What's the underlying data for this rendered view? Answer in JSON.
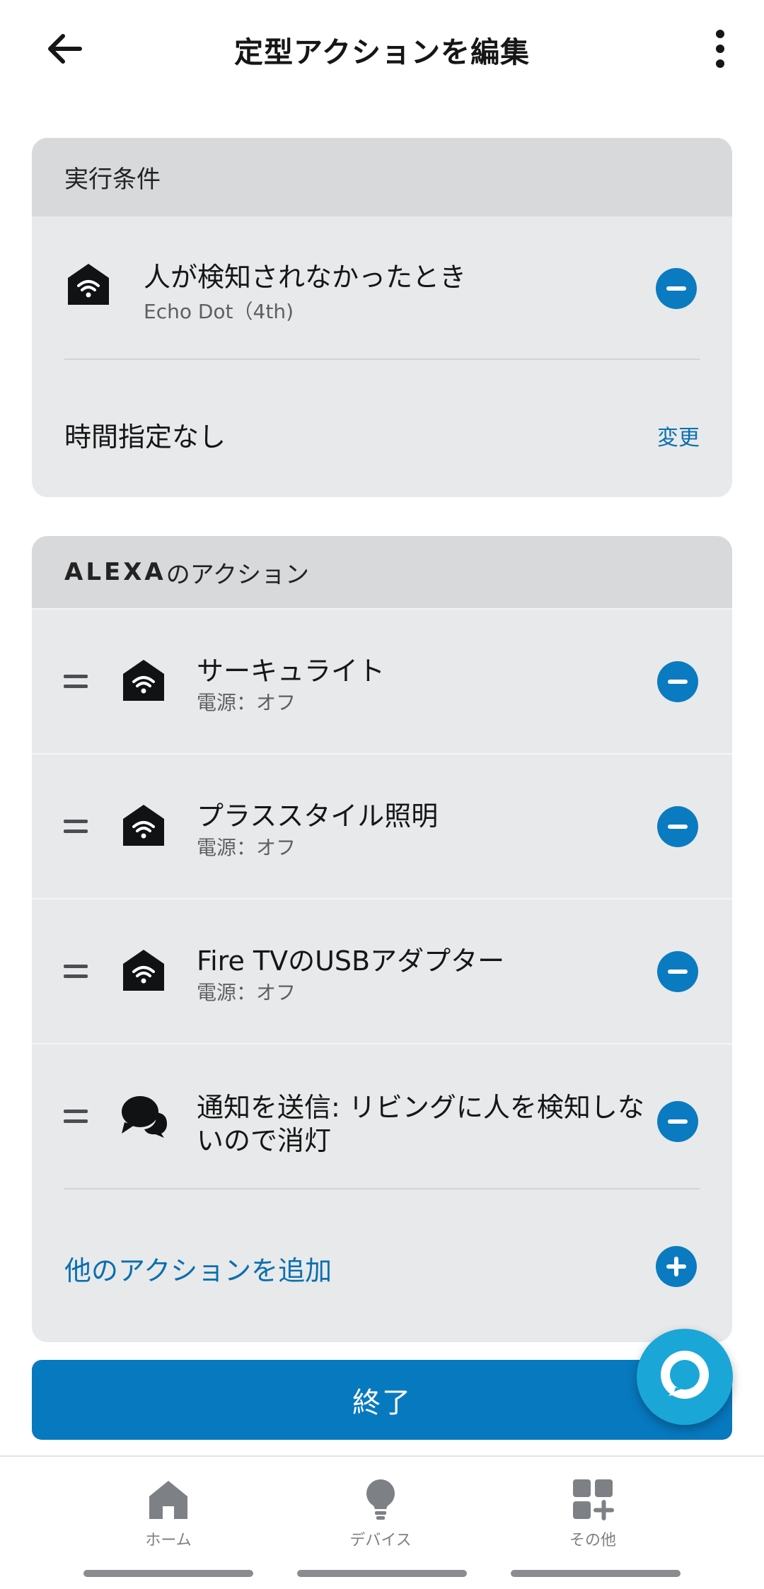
{
  "header": {
    "title": "定型アクションを編集",
    "back_icon": "arrow-left-icon",
    "more_icon": "kebab-menu-icon"
  },
  "trigger_card": {
    "heading": "実行条件",
    "trigger": {
      "title": "人が検知されなかったとき",
      "subtitle": "Echo Dot（4th)",
      "icon": "smart-home-icon"
    },
    "time": {
      "label": "時間指定なし",
      "change_label": "変更"
    }
  },
  "actions_card": {
    "heading_brand": "ALEXA",
    "heading_rest": "のアクション",
    "items": [
      {
        "title": "サーキュライト",
        "subtitle": "電源：オフ",
        "icon": "smart-home-icon"
      },
      {
        "title": "プラススタイル照明",
        "subtitle": "電源：オフ",
        "icon": "smart-home-icon"
      },
      {
        "title": "Fire TVのUSBアダプター",
        "subtitle": "電源：オフ",
        "icon": "smart-home-icon"
      },
      {
        "title_line1": "通知を送信: リビングに人を検知しな",
        "title_line2": "いので消灯",
        "icon": "speech-bubbles-icon"
      }
    ],
    "add_label": "他のアクションを追加"
  },
  "done_label": "終了",
  "bottom_nav": {
    "items": [
      {
        "label": "ホーム",
        "icon": "home-icon"
      },
      {
        "label": "デバイス",
        "icon": "lightbulb-icon"
      },
      {
        "label": "その他",
        "icon": "grid-plus-icon"
      }
    ]
  },
  "colors": {
    "accent": "#0779bf",
    "card_bg": "#e8e9ea",
    "card_header_bg": "#d8d9da",
    "alexa_fab": "#1ba6d8"
  }
}
